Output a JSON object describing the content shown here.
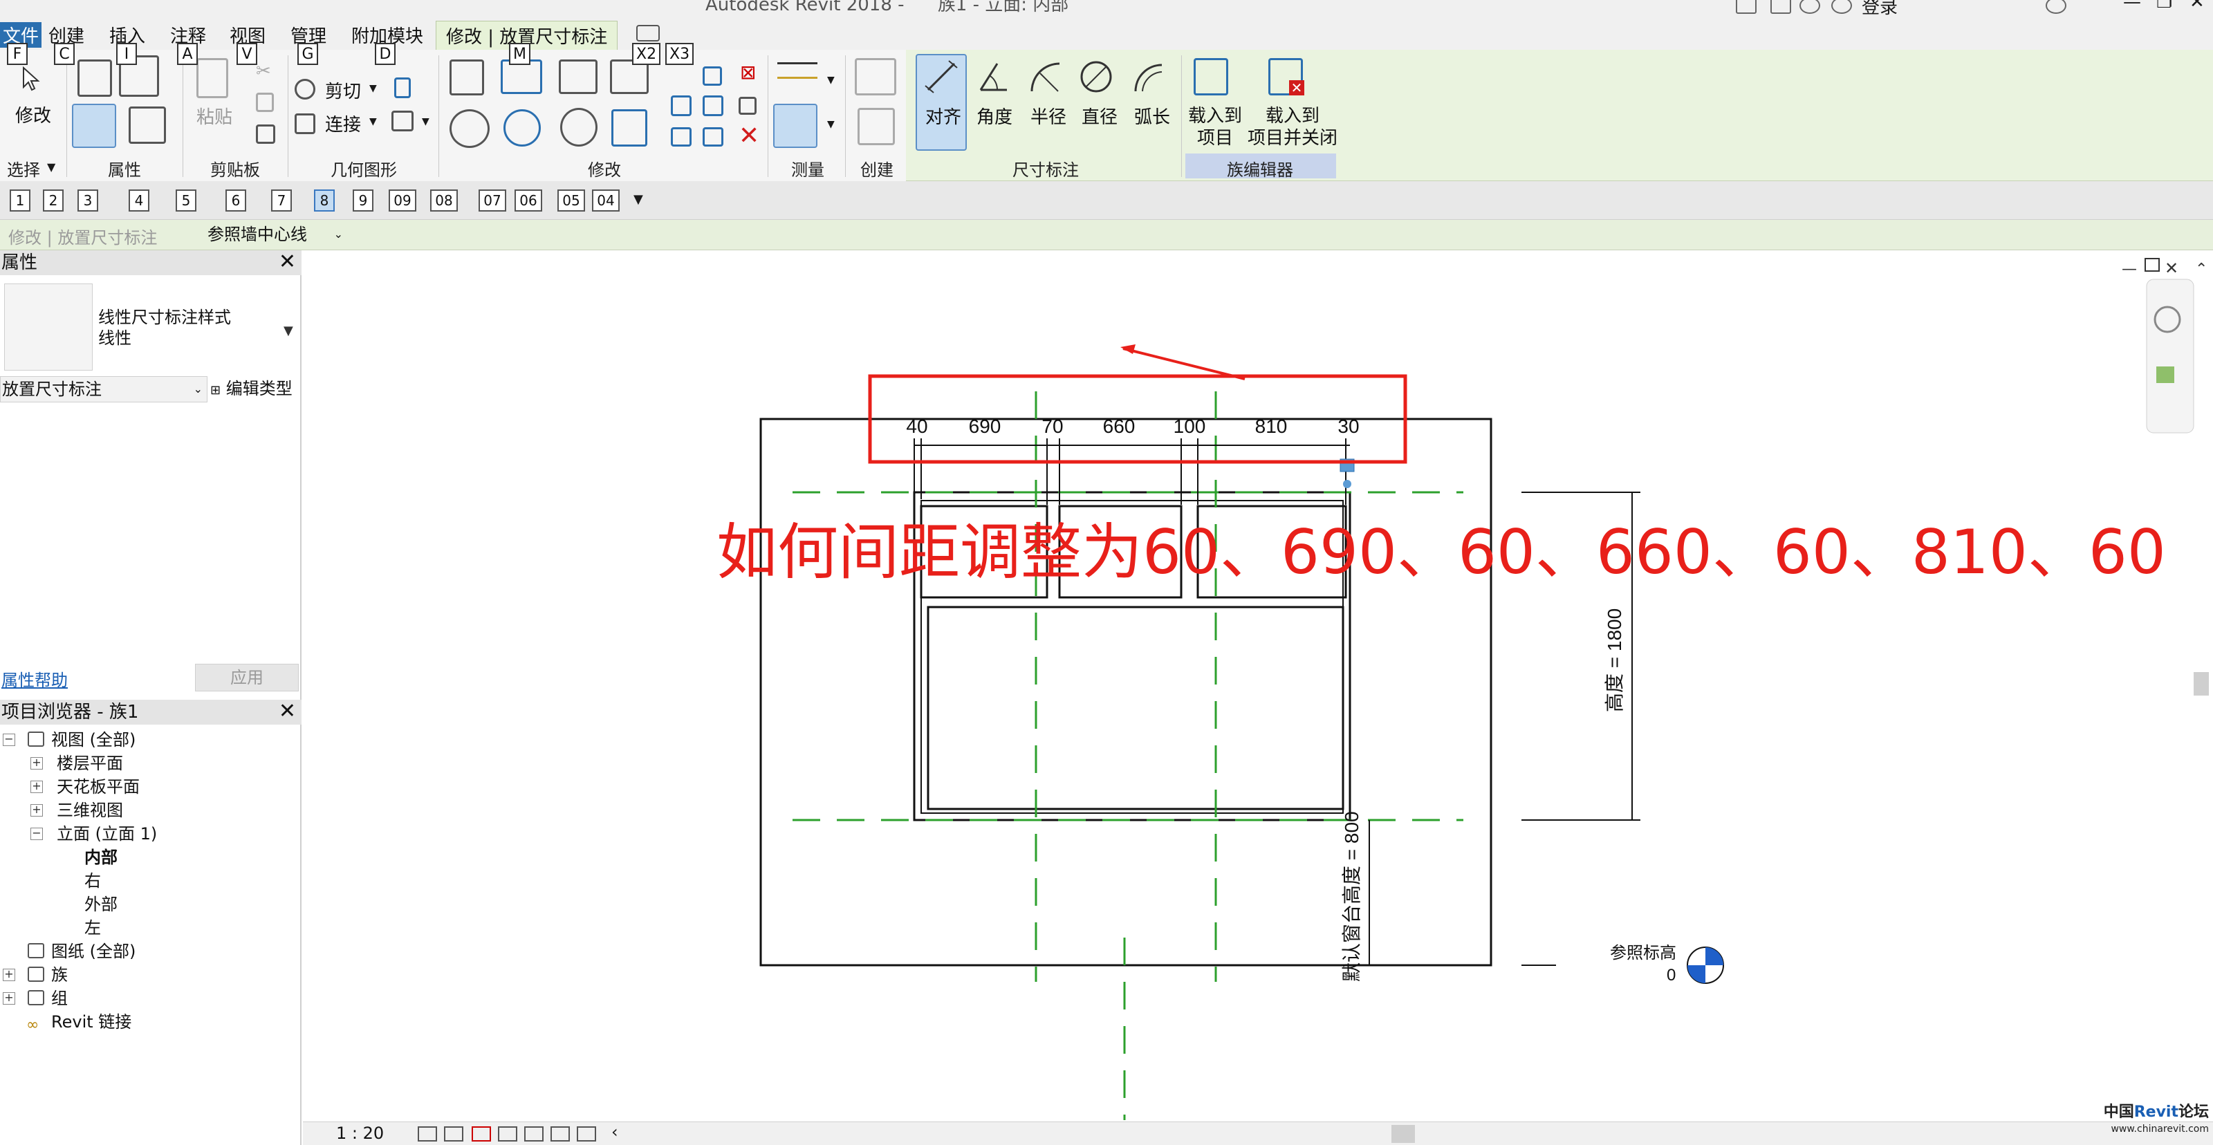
{
  "window": {
    "app_title": "Autodesk Revit 2018 -",
    "doc_title": "族1 - 立面: 内部",
    "signin": "登录"
  },
  "ribbon_tabs": [
    {
      "label": "文件",
      "keytip": "F"
    },
    {
      "label": "创建",
      "keytip": "C"
    },
    {
      "label": "插入",
      "keytip": "I"
    },
    {
      "label": "注释",
      "keytip": "A"
    },
    {
      "label": "视图",
      "keytip": "V"
    },
    {
      "label": "管理",
      "keytip": "G"
    },
    {
      "label": "附加模块",
      "keytip": "D"
    },
    {
      "label": "修改 | 放置尺寸标注",
      "keytip": "M"
    }
  ],
  "extra_keytips": [
    "X2",
    "X3"
  ],
  "ribbon": {
    "select_panel": {
      "button": "修改",
      "label": "选择"
    },
    "properties_panel": {
      "label": "属性"
    },
    "clipboard_panel": {
      "paste": "粘贴",
      "label": "剪贴板"
    },
    "geometry_panel": {
      "cut": "剪切",
      "join": "连接",
      "label": "几何图形"
    },
    "modify_panel": {
      "label": "修改"
    },
    "measure_panel": {
      "label": "测量"
    },
    "create_panel": {
      "label": "创建"
    },
    "dimension_panel": {
      "label": "尺寸标注",
      "buttons": [
        "对齐",
        "角度",
        "半径",
        "直径",
        "弧长"
      ]
    },
    "family_editor_panel": {
      "label": "族编辑器",
      "load_into_project": "载入到\n项目",
      "load_and_close": "载入到\n项目并关闭"
    }
  },
  "qat_keytips": [
    "1",
    "2",
    "3",
    "4",
    "5",
    "6",
    "7",
    "8",
    "9",
    "09",
    "08",
    "07",
    "06",
    "05",
    "04"
  ],
  "options_bar": {
    "context": "修改 | 放置尺寸标注",
    "reference": "参照墙中心线"
  },
  "properties": {
    "title": "属性",
    "type_name": "线性尺寸标注样式",
    "type_sub": "线性",
    "instance_filter": "放置尺寸标注",
    "edit_type": "编辑类型",
    "help": "属性帮助",
    "apply": "应用"
  },
  "project_browser": {
    "title": "项目浏览器 - 族1",
    "items": [
      {
        "label": "视图 (全部)"
      },
      {
        "label": "楼层平面"
      },
      {
        "label": "天花板平面"
      },
      {
        "label": "三维视图"
      },
      {
        "label": "立面 (立面 1)"
      },
      {
        "label": "内部"
      },
      {
        "label": "右"
      },
      {
        "label": "外部"
      },
      {
        "label": "左"
      },
      {
        "label": "图纸 (全部)"
      },
      {
        "label": "族"
      },
      {
        "label": "组"
      },
      {
        "label": "Revit 链接"
      }
    ]
  },
  "drawing": {
    "annotation": "如何间距调整为60、690、60、660、60、810、60",
    "dimension_values": [
      "40",
      "690",
      "70",
      "660",
      "100",
      "810",
      "30"
    ],
    "height_label": "高度 = 1800",
    "sill_label": "默认窗台高度 = 800",
    "ref_level_name": "参照标高",
    "ref_level_value": "0"
  },
  "status": {
    "scale": "1 : 20"
  },
  "watermark": {
    "line1a": "中国",
    "line1b": "Revit",
    "line1c": "论坛",
    "line2": "www.chinarevit.com"
  },
  "colors": {
    "annotation_red": "#e8201a",
    "ref_plane_green": "#2ca02c",
    "ribbon_green": "#eaf3df",
    "link_blue": "#1a5fb4"
  }
}
